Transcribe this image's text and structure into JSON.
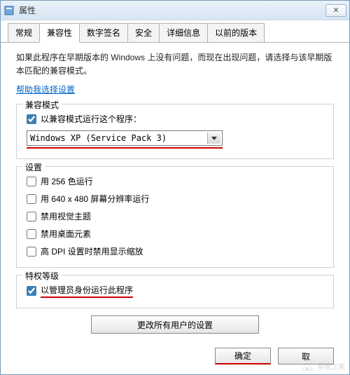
{
  "window": {
    "title": "属性"
  },
  "tabs": {
    "general": "常规",
    "compat": "兼容性",
    "sig": "数字签名",
    "security": "安全",
    "details": "详细信息",
    "prev": "以前的版本"
  },
  "description": "如果此程序在早期版本的 Windows 上没有问题，而现在出现问题，请选择与该早期版本匹配的兼容模式。",
  "help_link": "帮助我选择设置",
  "compat_mode": {
    "legend": "兼容模式",
    "run_checkbox": "以兼容模式运行这个程序：",
    "selected": "Windows XP (Service Pack 3)"
  },
  "settings": {
    "legend": "设置",
    "opt_256color": "用 256 色运行",
    "opt_640x480": "用 640 x 480 屏幕分辨率运行",
    "opt_theme": "禁用视觉主题",
    "opt_desktop": "禁用桌面元素",
    "opt_dpi": "高 DPI 设置时禁用显示缩放"
  },
  "privilege": {
    "legend": "特权等级",
    "run_admin": "以管理员身份运行此程序"
  },
  "all_users_button": "更改所有用户的设置",
  "buttons": {
    "ok": "确定",
    "cancel": "取"
  },
  "watermark": "系统之家"
}
